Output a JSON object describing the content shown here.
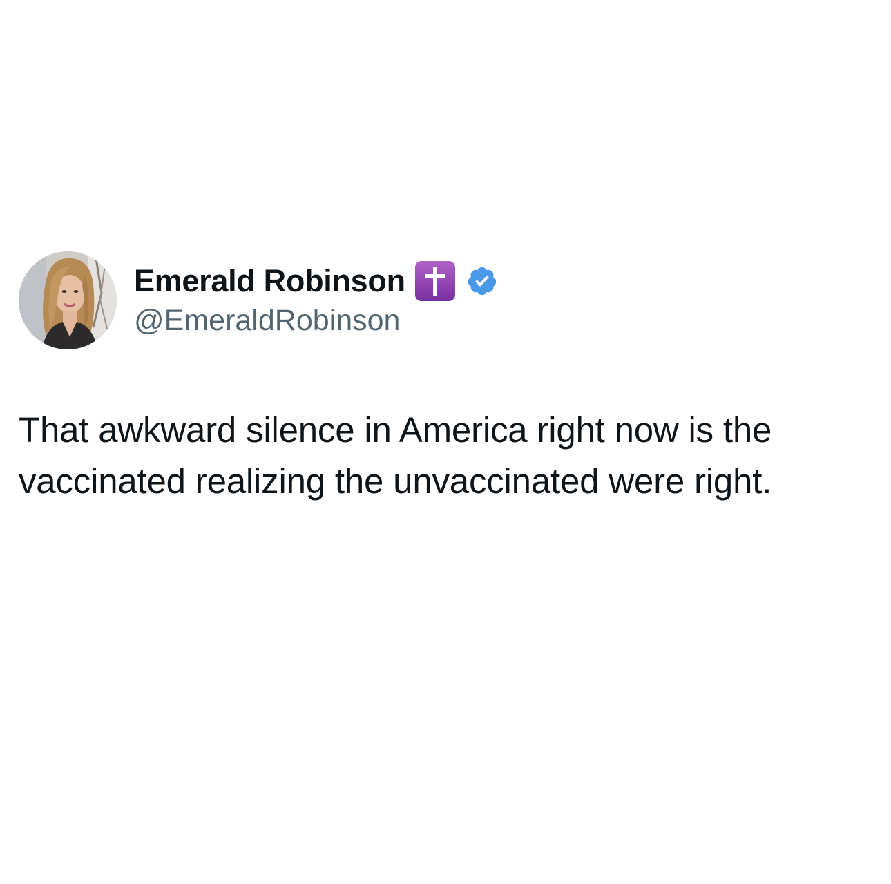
{
  "tweet": {
    "author": {
      "display_name": "Emerald Robinson",
      "handle": "@EmeraldRobinson",
      "name_emoji": "latin-cross-emoji",
      "verified": true,
      "verified_color": "#4a99e9",
      "emoji_color": "#9b4bbf"
    },
    "text_lines": [
      "That awkward silence in America right now is the",
      "vaccinated realizing the unvaccinated were right."
    ]
  }
}
